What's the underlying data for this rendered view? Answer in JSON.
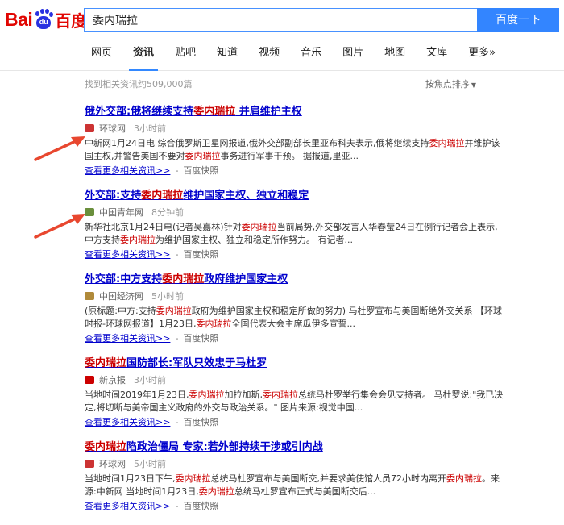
{
  "header": {
    "logo_bai": "Bai",
    "logo_du": "du",
    "logo_cn": "百度",
    "search_value": "委内瑞拉",
    "search_button": "百度一下"
  },
  "tabs": [
    {
      "label": "网页"
    },
    {
      "label": "资讯"
    },
    {
      "label": "贴吧"
    },
    {
      "label": "知道"
    },
    {
      "label": "视频"
    },
    {
      "label": "音乐"
    },
    {
      "label": "图片"
    },
    {
      "label": "地图"
    },
    {
      "label": "文库"
    },
    {
      "label": "更多»"
    }
  ],
  "active_tab": "资讯",
  "toolbar": {
    "result_count": "找到相关资讯约509,000篇",
    "sort_label": "按焦点排序"
  },
  "results": [
    {
      "title": [
        {
          "t": "俄外交部:俄将继续支持",
          "hl": false
        },
        {
          "t": "委内瑞拉",
          "hl": true
        },
        {
          "t": " 并肩维护主权",
          "hl": false
        }
      ],
      "source": "环球网",
      "time": "3小时前",
      "source_icon_color": "#c33",
      "abstract": [
        {
          "t": "中新网1月24日电 综合俄罗斯卫星网报道,俄外交部副部长里亚布科夫表示,俄将继续支持",
          "hl": false
        },
        {
          "t": "委内瑞拉",
          "hl": true
        },
        {
          "t": "并维护该国主权,并警告美国不要对",
          "hl": false
        },
        {
          "t": "委内瑞拉",
          "hl": true
        },
        {
          "t": "事务进行军事干预。 据报道,里亚...",
          "hl": false
        }
      ],
      "more_link": "查看更多相关资讯>>",
      "separator": "-",
      "snapshot": "百度快照"
    },
    {
      "title": [
        {
          "t": "外交部:支持",
          "hl": false
        },
        {
          "t": "委内瑞拉",
          "hl": true
        },
        {
          "t": "维护国家主权、独立和稳定",
          "hl": false
        }
      ],
      "source": "中国青年网",
      "time": "8分钟前",
      "source_icon_color": "#6a8f3c",
      "abstract": [
        {
          "t": "新华社北京1月24日电(记者吴嘉林)针对",
          "hl": false
        },
        {
          "t": "委内瑞拉",
          "hl": true
        },
        {
          "t": "当前局势,外交部发言人华春莹24日在例行记者会上表示,中方支持",
          "hl": false
        },
        {
          "t": "委内瑞拉",
          "hl": true
        },
        {
          "t": "为维护国家主权、独立和稳定所作努力。 有记者...",
          "hl": false
        }
      ],
      "more_link": "查看更多相关资讯>>",
      "separator": "-",
      "snapshot": "百度快照"
    },
    {
      "title": [
        {
          "t": "外交部:中方支持",
          "hl": false
        },
        {
          "t": "委内瑞拉",
          "hl": true
        },
        {
          "t": "政府维护国家主权",
          "hl": false
        }
      ],
      "source": "中国经济网",
      "time": "5小时前",
      "source_icon_color": "#b08a3a",
      "abstract": [
        {
          "t": "(原标题:中方:支持",
          "hl": false
        },
        {
          "t": "委内瑞拉",
          "hl": true
        },
        {
          "t": "政府为维护国家主权和稳定所做的努力) 马杜罗宣布与美国断绝外交关系 【环球时报-环球网报道】1月23日,",
          "hl": false
        },
        {
          "t": "委内瑞拉",
          "hl": true
        },
        {
          "t": "全国代表大会主席瓜伊多宣誓...",
          "hl": false
        }
      ],
      "more_link": "查看更多相关资讯>>",
      "separator": "-",
      "snapshot": "百度快照"
    },
    {
      "title": [
        {
          "t": "委内瑞拉",
          "hl": true
        },
        {
          "t": "国防部长:军队只效忠于马杜罗",
          "hl": false
        }
      ],
      "source": "新京报",
      "time": "3小时前",
      "source_icon_color": "#c00",
      "abstract": [
        {
          "t": "当地时间2019年1月23日,",
          "hl": false
        },
        {
          "t": "委内瑞拉",
          "hl": true
        },
        {
          "t": "加拉加斯,",
          "hl": false
        },
        {
          "t": "委内瑞拉",
          "hl": true
        },
        {
          "t": "总统马杜罗举行集会会见支持者。 马杜罗说:\"我已决定,将切断与美帝国主义政府的外交与政治关系。\" 图片来源:视觉中国...",
          "hl": false
        }
      ],
      "more_link": "查看更多相关资讯>>",
      "separator": "-",
      "snapshot": "百度快照"
    },
    {
      "title": [
        {
          "t": "委内瑞拉",
          "hl": true
        },
        {
          "t": "陷政治僵局 专家:若外部持续干涉或引内战",
          "hl": false
        }
      ],
      "source": "环球网",
      "time": "5小时前",
      "source_icon_color": "#c33",
      "abstract": [
        {
          "t": "当地时间1月23日下午,",
          "hl": false
        },
        {
          "t": "委内瑞拉",
          "hl": true
        },
        {
          "t": "总统马杜罗宣布与美国断交,并要求美使馆人员72小时内离开",
          "hl": false
        },
        {
          "t": "委内瑞拉",
          "hl": true
        },
        {
          "t": "。来源:中新网 当地时间1月23日,",
          "hl": false
        },
        {
          "t": "委内瑞拉",
          "hl": true
        },
        {
          "t": "总统马杜罗宣布正式与美国断交后...",
          "hl": false
        }
      ],
      "more_link": "查看更多相关资讯>>",
      "separator": "-",
      "snapshot": "百度快照"
    }
  ]
}
